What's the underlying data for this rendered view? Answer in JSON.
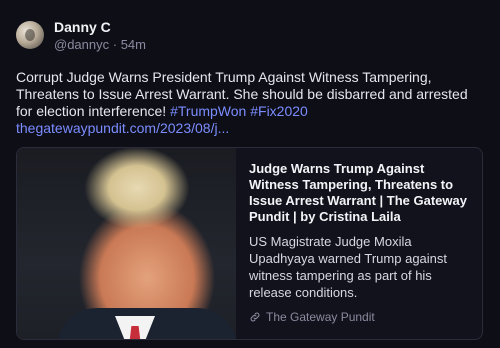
{
  "post": {
    "author_name": "Danny C",
    "handle": "@dannyc",
    "separator": " · ",
    "time": "54m",
    "text_main": "Corrupt Judge Warns President Trump Against Witness Tampering, Threatens to Issue Arrest Warrant. She should be disbarred and arrested for election interference! ",
    "hashtag1": "#TrumpWon",
    "hashtag2": "#Fix2020",
    "link_text": "thegatewaypundit.com/2023/08/j..."
  },
  "card": {
    "title": "Judge Warns Trump Against Witness Tampering, Threatens to Issue Arrest Warrant | The Gateway Pundit | by Cristina Laila",
    "description": "US Magistrate Judge Moxila Upadhyaya warned Trump against witness tampering as part of his release conditions.",
    "source": "The Gateway Pundit",
    "icon": "link-icon"
  },
  "colors": {
    "background": "#0e0e16",
    "link": "#7b8cff",
    "muted": "#8a8aa0",
    "card_border": "#2b2b3a"
  }
}
